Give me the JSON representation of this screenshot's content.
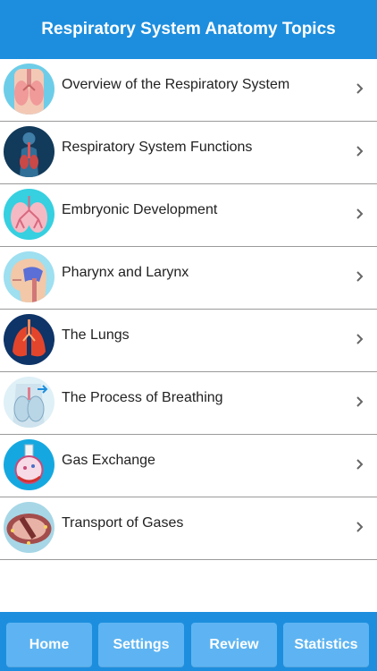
{
  "header": {
    "title": "Respiratory System Anatomy Topics"
  },
  "colors": {
    "primary": "#1d8ede",
    "tab_button": "#5eb4f2",
    "divider": "#9a9a9a"
  },
  "topics": [
    {
      "label": "Overview of the Respiratory System",
      "icon": "lungs-torso-icon"
    },
    {
      "label": "Respiratory System Functions",
      "icon": "airway-body-icon"
    },
    {
      "label": "Embryonic Development",
      "icon": "bronchial-tree-icon"
    },
    {
      "label": "Pharynx and Larynx",
      "icon": "head-profile-icon"
    },
    {
      "label": "The Lungs",
      "icon": "red-lungs-icon"
    },
    {
      "label": "The Process of Breathing",
      "icon": "breathing-lungs-icon"
    },
    {
      "label": "Gas Exchange",
      "icon": "alveolus-flask-icon"
    },
    {
      "label": "Transport of Gases",
      "icon": "capillary-icon"
    }
  ],
  "tabs": [
    {
      "label": "Home"
    },
    {
      "label": "Settings"
    },
    {
      "label": "Review"
    },
    {
      "label": "Statistics"
    }
  ]
}
